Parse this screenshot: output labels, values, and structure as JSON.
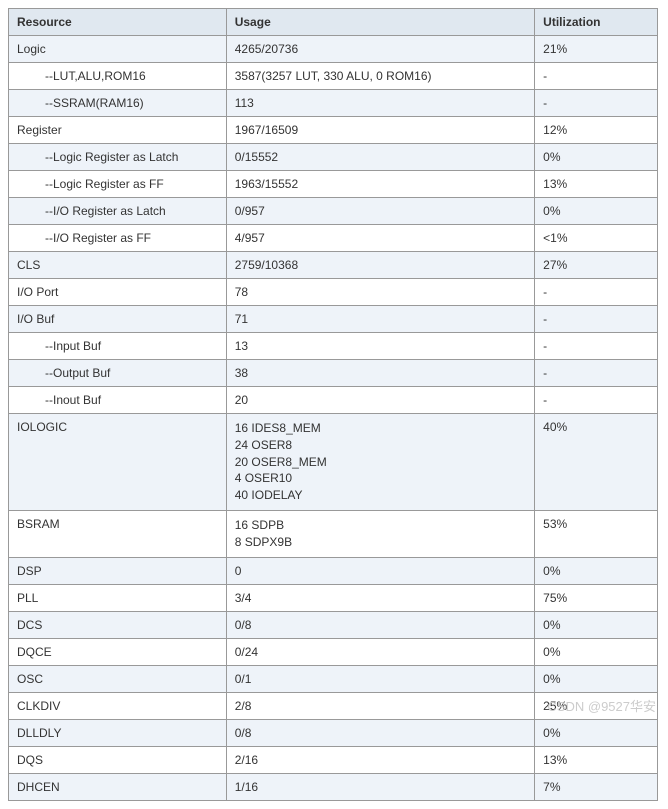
{
  "headers": {
    "resource": "Resource",
    "usage": "Usage",
    "utilization": "Utilization"
  },
  "rows": [
    {
      "resource": "Logic",
      "usage": "4265/20736",
      "utilization": "21%",
      "indent": false,
      "alt": true
    },
    {
      "resource": "--LUT,ALU,ROM16",
      "usage": "3587(3257 LUT, 330 ALU, 0 ROM16)",
      "utilization": "-",
      "indent": true,
      "alt": false
    },
    {
      "resource": "--SSRAM(RAM16)",
      "usage": "113",
      "utilization": "-",
      "indent": true,
      "alt": true
    },
    {
      "resource": "Register",
      "usage": "1967/16509",
      "utilization": "12%",
      "indent": false,
      "alt": false
    },
    {
      "resource": "--Logic Register as Latch",
      "usage": "0/15552",
      "utilization": "0%",
      "indent": true,
      "alt": true
    },
    {
      "resource": "--Logic Register as FF",
      "usage": "1963/15552",
      "utilization": "13%",
      "indent": true,
      "alt": false
    },
    {
      "resource": "--I/O Register as Latch",
      "usage": "0/957",
      "utilization": "0%",
      "indent": true,
      "alt": true
    },
    {
      "resource": "--I/O Register as FF",
      "usage": "4/957",
      "utilization": "<1%",
      "indent": true,
      "alt": false
    },
    {
      "resource": "CLS",
      "usage": "2759/10368",
      "utilization": "27%",
      "indent": false,
      "alt": true
    },
    {
      "resource": "I/O Port",
      "usage": "78",
      "utilization": "-",
      "indent": false,
      "alt": false
    },
    {
      "resource": "I/O Buf",
      "usage": "71",
      "utilization": "-",
      "indent": false,
      "alt": true
    },
    {
      "resource": "--Input Buf",
      "usage": "13",
      "utilization": "-",
      "indent": true,
      "alt": false
    },
    {
      "resource": "--Output Buf",
      "usage": "38",
      "utilization": "-",
      "indent": true,
      "alt": true
    },
    {
      "resource": "--Inout Buf",
      "usage": "20",
      "utilization": "-",
      "indent": true,
      "alt": false
    },
    {
      "resource": "IOLOGIC",
      "usage": "16 IDES8_MEM\n24 OSER8\n20 OSER8_MEM\n4 OSER10\n40 IODELAY",
      "utilization": "40%",
      "indent": false,
      "alt": true,
      "multiline": true
    },
    {
      "resource": "BSRAM",
      "usage": "16 SDPB\n8 SDPX9B",
      "utilization": "53%",
      "indent": false,
      "alt": false,
      "multiline": true
    },
    {
      "resource": "DSP",
      "usage": "0",
      "utilization": "0%",
      "indent": false,
      "alt": true
    },
    {
      "resource": "PLL",
      "usage": "3/4",
      "utilization": "75%",
      "indent": false,
      "alt": false
    },
    {
      "resource": "DCS",
      "usage": "0/8",
      "utilization": "0%",
      "indent": false,
      "alt": true
    },
    {
      "resource": "DQCE",
      "usage": "0/24",
      "utilization": "0%",
      "indent": false,
      "alt": false
    },
    {
      "resource": "OSC",
      "usage": "0/1",
      "utilization": "0%",
      "indent": false,
      "alt": true
    },
    {
      "resource": "CLKDIV",
      "usage": "2/8",
      "utilization": "25%",
      "indent": false,
      "alt": false
    },
    {
      "resource": "DLLDLY",
      "usage": "0/8",
      "utilization": "0%",
      "indent": false,
      "alt": true
    },
    {
      "resource": "DQS",
      "usage": "2/16",
      "utilization": "13%",
      "indent": false,
      "alt": false
    },
    {
      "resource": "DHCEN",
      "usage": "1/16",
      "utilization": "7%",
      "indent": false,
      "alt": true
    }
  ],
  "watermark": "CSDN @9527华安"
}
